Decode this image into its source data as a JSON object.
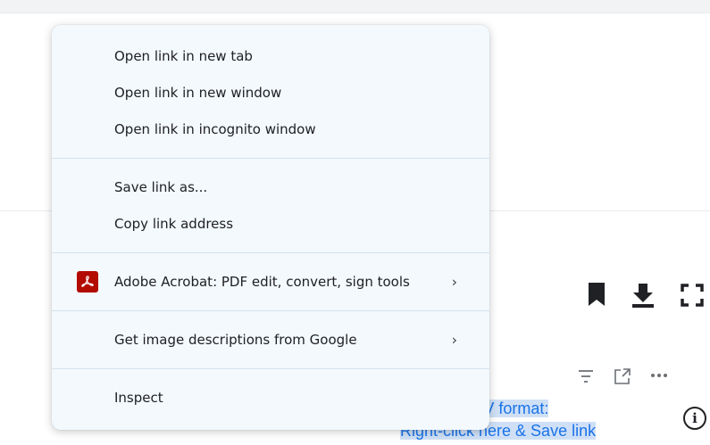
{
  "context_menu": {
    "items": {
      "open_new_tab": "Open link in new tab",
      "open_new_window": "Open link in new window",
      "open_incognito": "Open link in incognito window",
      "save_link_as": "Save link as...",
      "copy_link_address": "Copy link address",
      "adobe_acrobat": "Adobe Acrobat: PDF edit, convert, sign tools",
      "image_descriptions": "Get image descriptions from Google",
      "inspect": "Inspect"
    }
  },
  "page": {
    "csv_link": {
      "line1": "DATA in CSV format:",
      "line2": "Right-click here & Save link"
    }
  },
  "icons": {
    "bookmark": "bookmark-icon",
    "download": "download-icon",
    "fullscreen": "fullscreen-icon",
    "filter": "filter-icon",
    "expand": "expand-icon",
    "more": "more-icon",
    "info": "info-icon",
    "acrobat": "acrobat-icon",
    "chevron": "chevron-right-icon"
  },
  "colors": {
    "menu_bg": "#f3f9fd",
    "acrobat_red": "#b30b00",
    "link_blue": "#1a73e8",
    "link_highlight": "#cfe0f6"
  }
}
